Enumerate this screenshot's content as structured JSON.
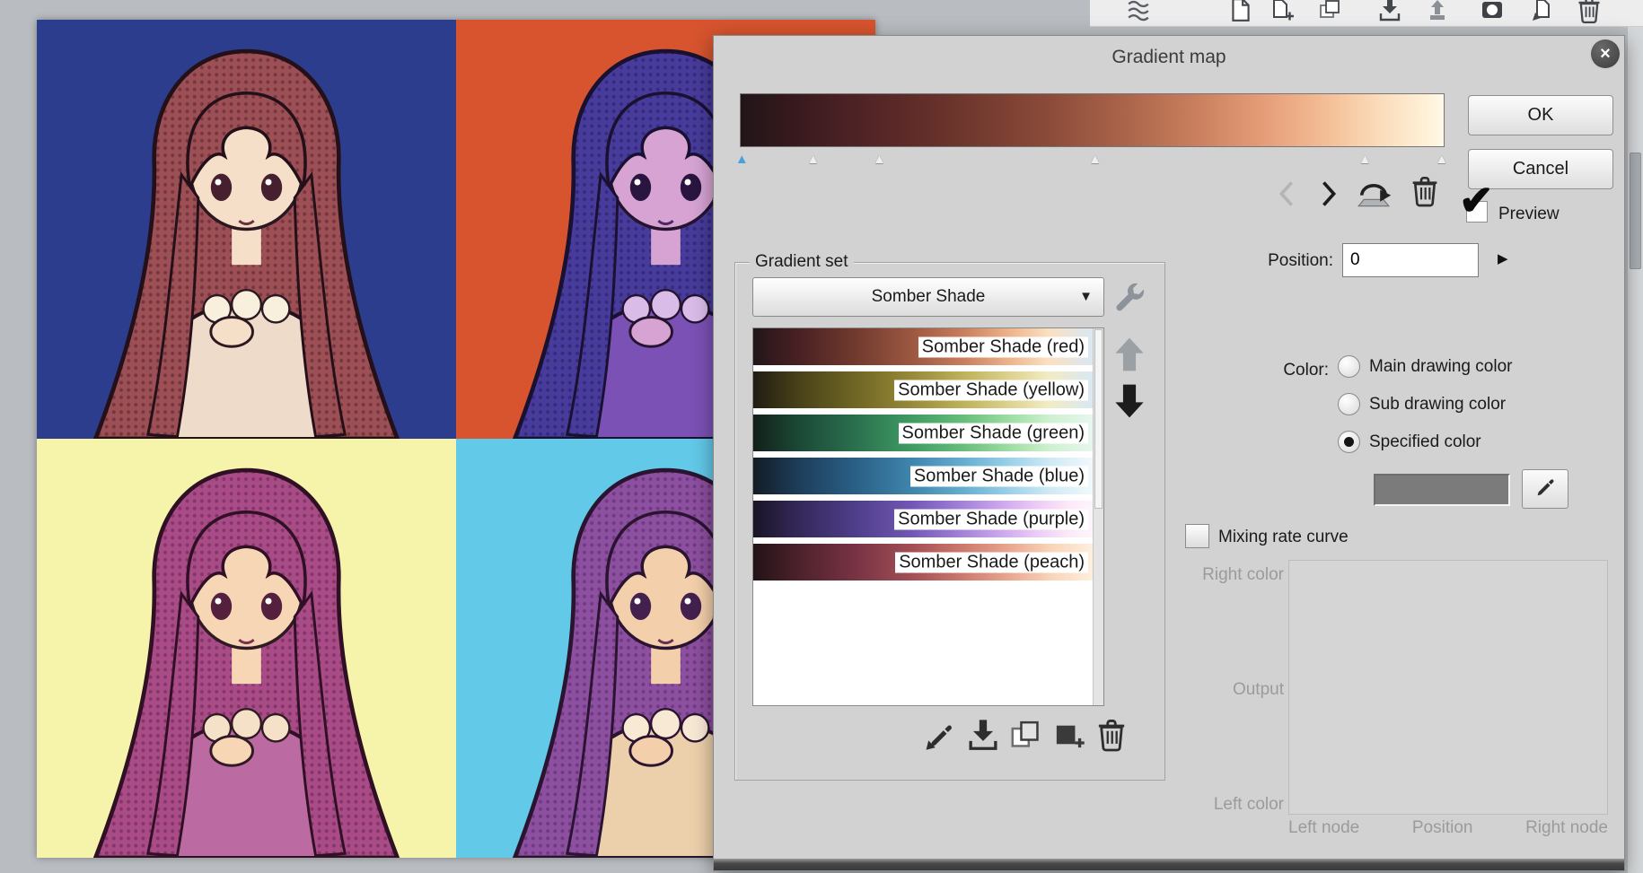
{
  "workspace": {
    "colors": {
      "background": "#b9bdc1",
      "toolbar": "#ededee",
      "dialog": "#d2d2d2"
    }
  },
  "top_toolbar": {
    "icons": [
      "layer-list-icon",
      "new-layer-icon",
      "new-layer-2-icon",
      "new-folder-icon",
      "transfer-down-icon",
      "combine-down-icon",
      "layer-mask-icon",
      "apply-layer-icon",
      "delete-layer-icon"
    ]
  },
  "canvas": {
    "quadrants": [
      {
        "name": "top-left",
        "bg": "#2d3d8e",
        "hair": "#9c4f55",
        "hair_dark": "#55232c",
        "skin": "#f6dfc9",
        "dress": "#eedbc9",
        "frill": "#f8efdd",
        "eye": "#46202e"
      },
      {
        "name": "top-right",
        "bg": "#d7542e",
        "hair": "#473c9c",
        "hair_dark": "#281c5e",
        "skin": "#d6a3d3",
        "dress": "#7b51b5",
        "frill": "#d9bce8",
        "eye": "#2a1440"
      },
      {
        "name": "bottom-left",
        "bg": "#f6f3ab",
        "hair": "#a94b86",
        "hair_dark": "#642550",
        "skin": "#f7d6b6",
        "dress": "#bb6ba2",
        "frill": "#f4e1c8",
        "eye": "#54203e"
      },
      {
        "name": "bottom-right",
        "bg": "#62c9e9",
        "hair": "#8d4f9f",
        "hair_dark": "#532a66",
        "skin": "#f3cfab",
        "dress": "#ecd0ab",
        "frill": "#f7e9d4",
        "eye": "#44204e"
      }
    ]
  },
  "dialog": {
    "title": "Gradient map",
    "close_glyph": "×",
    "icons": {
      "nav": [
        "prev-gradient-icon",
        "next-gradient-icon",
        "flip-gradient-icon",
        "delete-node-icon"
      ],
      "list_tools": [
        "pick-gradient-icon",
        "import-gradient-icon",
        "duplicate-gradient-icon",
        "add-gradient-icon",
        "delete-gradient-icon"
      ],
      "other": [
        "close-icon",
        "wrench-icon",
        "chevron-down-icon",
        "position-step-icon",
        "list-up-icon",
        "list-down-icon",
        "eyedropper-icon"
      ]
    },
    "gradient_bar": {
      "css": "linear-gradient(90deg,#211518 0%,#35191d 7%,#4b2124 15%,#5e2b28 24%,#71392e 33%,#8c4b39 44%,#ab654b 55%,#ca805e 65%,#e49c77 74%,#f3bd95 83%,#fbdcba 91%,#fef2da 98%,#fff9ea 100%)",
      "selected_color": "#4aa0da",
      "nodes": [
        {
          "left": "0.3%",
          "selected": true
        },
        {
          "left": "10.4%",
          "selected": false
        },
        {
          "left": "19.8%",
          "selected": false
        },
        {
          "left": "50.4%",
          "selected": false
        },
        {
          "left": "88.7%",
          "selected": false
        },
        {
          "left": "99.6%",
          "selected": false
        }
      ]
    },
    "buttons": {
      "ok": "OK",
      "cancel": "Cancel"
    },
    "preview": {
      "label": "Preview",
      "checked": true,
      "check_glyph": "✔"
    },
    "position": {
      "label": "Position:",
      "value": "0",
      "arrow_glyph": "▶"
    },
    "gradient_set": {
      "label": "Gradient set",
      "dropdown_value": "Somber Shade",
      "dropdown_arrow_glyph": "▼",
      "items": [
        {
          "label": "Somber Shade (red)",
          "css": "linear-gradient(90deg,#221619 0%,#4b2124 14%,#713a2e 30%,#9d5841 47%,#c97e5d 62%,#eeb68e 76%,#fbe0c1 87%,#d9e8f3 100%)"
        },
        {
          "label": "Somber Shade (yellow)",
          "css": "linear-gradient(90deg,#201c12 0%,#4a4319 14%,#6f6524 30%,#988a39 47%,#beb25b 62%,#ded391 76%,#f2ecc3 87%,#d9e8f3 100%)"
        },
        {
          "label": "Somber Shade (green)",
          "css": "linear-gradient(90deg,#122019 0%,#1c4a37 14%,#2a6f4e 30%,#3f9c63 47%,#67be7b 62%,#a0dea5 76%,#cdf0ce 87%,#e7f6f0 100%)"
        },
        {
          "label": "Somber Shade (blue)",
          "css": "linear-gradient(90deg,#131c25 0%,#1d3f5c 14%,#2a5f85 30%,#3f86ad 47%,#65aed1 62%,#9dd2e9 76%,#cee9f5 87%,#f1f9fc 100%)"
        },
        {
          "label": "Somber Shade (purple)",
          "css": "linear-gradient(90deg,#1a1526 0%,#35295c 14%,#4e3e89 30%,#7258b5 47%,#9d7dd5 60%,#c9a3ec 72%,#ebc9f6 83%,#fce9f9 93%,#fdf5fb 100%)"
        },
        {
          "label": "Somber Shade (peach)",
          "css": "linear-gradient(90deg,#221317 0%,#4e222c 14%,#773343 30%,#a44f56 47%,#cd7a6e 62%,#eaa992 76%,#f9d5b9 88%,#feefde 100%)"
        }
      ]
    },
    "color_section": {
      "label": "Color:",
      "options": [
        {
          "label": "Main drawing color",
          "selected": false
        },
        {
          "label": "Sub drawing color",
          "selected": false
        },
        {
          "label": "Specified color",
          "selected": true
        }
      ],
      "swatch_color": "#7b7b7b"
    },
    "mixing": {
      "label": "Mixing rate curve",
      "checked": false
    },
    "curve_panel": {
      "right_color": "Right color",
      "output": "Output",
      "left_color": "Left color",
      "left_node": "Left node",
      "position": "Position",
      "right_node": "Right node"
    }
  }
}
